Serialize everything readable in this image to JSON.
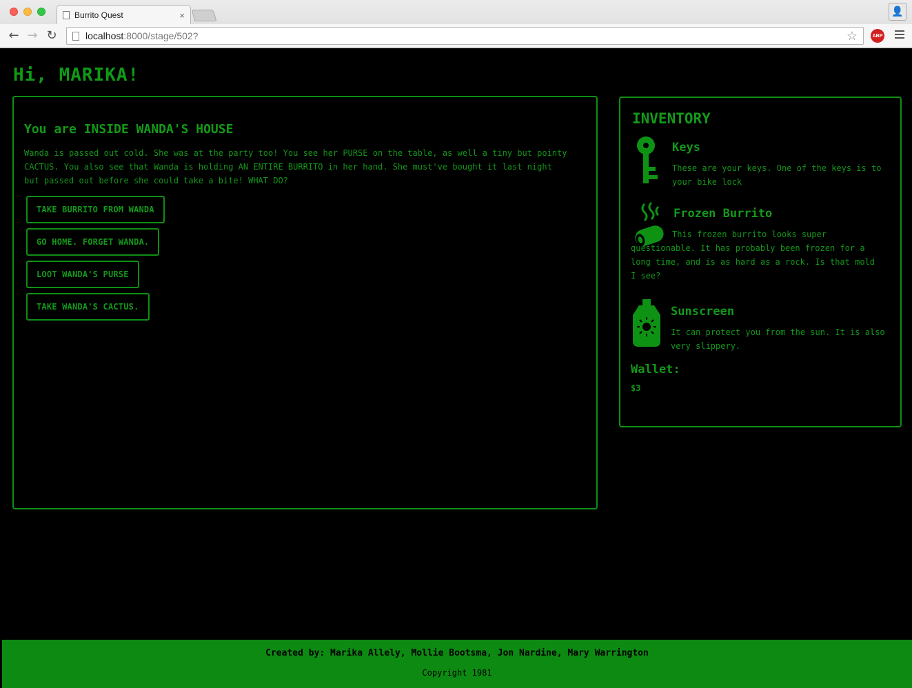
{
  "browser": {
    "tab_title": "Burrito Quest",
    "tab_close": "×",
    "url_host": "localhost",
    "url_path": ":8000/stage/502?",
    "adblock_label": "ABP"
  },
  "greeting": "Hi, MARIKA!",
  "stage": {
    "heading": "You are INSIDE WANDA'S HOUSE",
    "description": "Wanda is passed out cold. She was at the party too! You see her PURSE on the table, as well a tiny but pointy CACTUS. You also see that Wanda is holding AN ENTIRE BURRITO in her hand. She must've bought it last night but passed out before she could take a bite! WHAT DO?",
    "choices": [
      "TAKE BURRITO FROM WANDA",
      "GO HOME. FORGET WANDA.",
      "LOOT WANDA'S PURSE",
      "TAKE WANDA'S CACTUS."
    ]
  },
  "inventory": {
    "title": "INVENTORY",
    "items": [
      {
        "name": "Keys",
        "icon": "key-icon",
        "description": "These are your keys. One of the keys is to your bike lock"
      },
      {
        "name": "Frozen Burrito",
        "icon": "burrito-icon",
        "description": "This frozen burrito looks super questionable. It has probably been frozen for a long time, and is as hard as a rock. Is that mold I see?"
      },
      {
        "name": "Sunscreen",
        "icon": "sunscreen-icon",
        "description": "It can protect you from the sun. It is also very slippery."
      }
    ],
    "wallet_label": "Wallet:",
    "wallet_value": "$3"
  },
  "footer": {
    "credits": "Created by: Marika Allely, Mollie Bootsma, Jon Nardine, Mary Warrington",
    "copyright": "Copyright 1981"
  },
  "colors": {
    "accent": "#0e8f14",
    "background": "#000000"
  }
}
